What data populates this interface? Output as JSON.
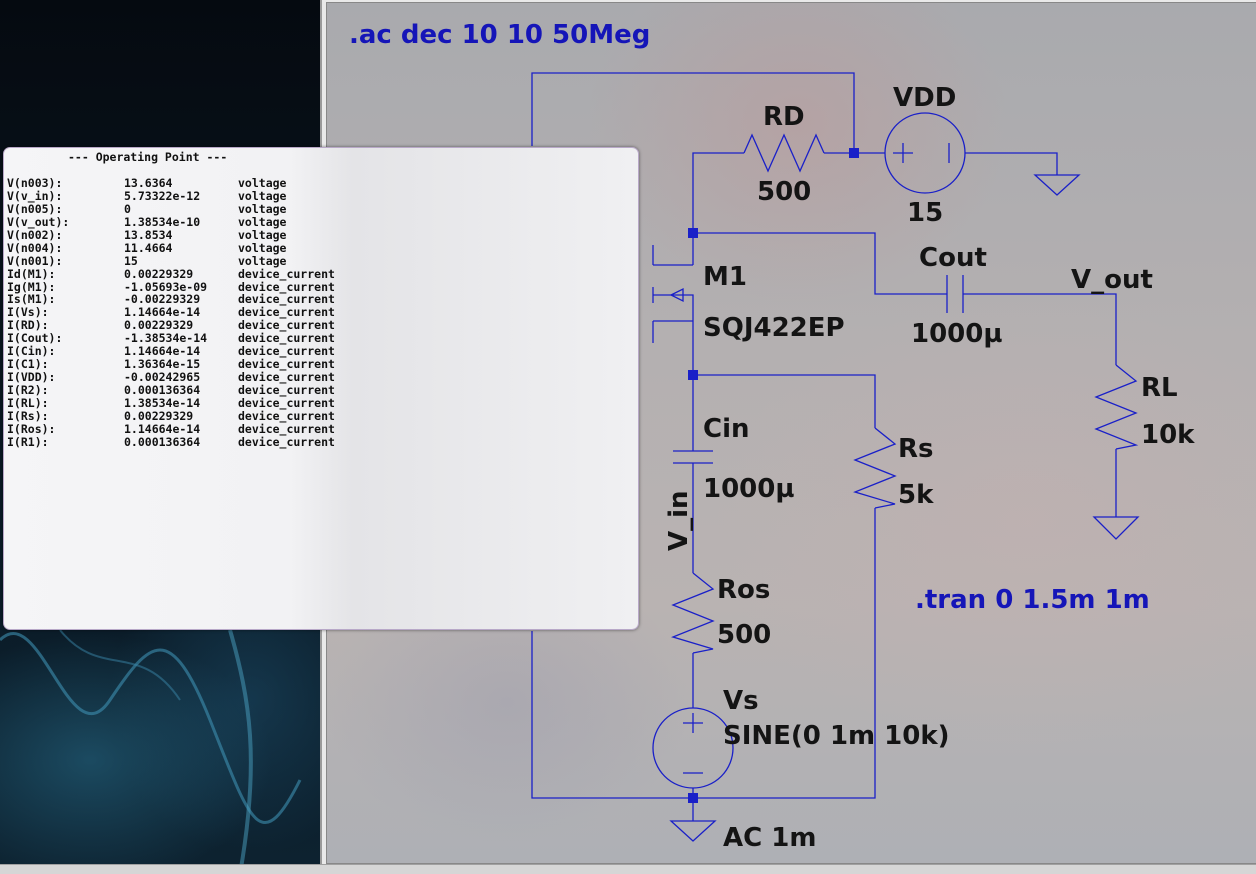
{
  "schematic": {
    "directives": {
      "ac": ".ac dec 10 10 50Meg",
      "tran": ".tran 0 1.5m 1m"
    },
    "components": {
      "rd": {
        "name": "RD",
        "value": "500"
      },
      "vdd": {
        "name": "VDD",
        "value": "15"
      },
      "m1": {
        "name": "M1",
        "model": "SQJ422EP"
      },
      "cout": {
        "name": "Cout",
        "value": "1000µ"
      },
      "rl": {
        "name": "RL",
        "value": "10k"
      },
      "cin": {
        "name": "Cin",
        "value": "1000µ"
      },
      "rs": {
        "name": "Rs",
        "value": "5k"
      },
      "ros": {
        "name": "Ros",
        "value": "500"
      },
      "vs": {
        "name": "Vs",
        "value": "SINE(0 1m 10k)",
        "ac": "AC 1m"
      }
    },
    "nets": {
      "v_out": "V_out",
      "v_in": "V_in"
    },
    "colors": {
      "wire": "#1a20c8",
      "directive": "#1515b8",
      "label": "#141414"
    }
  },
  "operating_point": {
    "title": "--- Operating Point ---",
    "rows": [
      {
        "name": "V(n003):",
        "value": "13.6364",
        "unit": "voltage"
      },
      {
        "name": "V(v_in):",
        "value": "5.73322e-12",
        "unit": "voltage"
      },
      {
        "name": "V(n005):",
        "value": "0",
        "unit": "voltage"
      },
      {
        "name": "V(v_out):",
        "value": "1.38534e-10",
        "unit": "voltage"
      },
      {
        "name": "V(n002):",
        "value": "13.8534",
        "unit": "voltage"
      },
      {
        "name": "V(n004):",
        "value": "11.4664",
        "unit": "voltage"
      },
      {
        "name": "V(n001):",
        "value": "15",
        "unit": "voltage"
      },
      {
        "name": "Id(M1):",
        "value": "0.00229329",
        "unit": "device_current"
      },
      {
        "name": "Ig(M1):",
        "value": "-1.05693e-09",
        "unit": "device_current"
      },
      {
        "name": "Is(M1):",
        "value": "-0.00229329",
        "unit": "device_current"
      },
      {
        "name": "I(Vs):",
        "value": "1.14664e-14",
        "unit": "device_current"
      },
      {
        "name": "I(RD):",
        "value": "0.00229329",
        "unit": "device_current"
      },
      {
        "name": "I(Cout):",
        "value": "-1.38534e-14",
        "unit": "device_current"
      },
      {
        "name": "I(Cin):",
        "value": "1.14664e-14",
        "unit": "device_current"
      },
      {
        "name": "I(C1):",
        "value": "1.36364e-15",
        "unit": "device_current"
      },
      {
        "name": "I(VDD):",
        "value": "-0.00242965",
        "unit": "device_current"
      },
      {
        "name": "I(R2):",
        "value": "0.000136364",
        "unit": "device_current"
      },
      {
        "name": "I(RL):",
        "value": "1.38534e-14",
        "unit": "device_current"
      },
      {
        "name": "I(Rs):",
        "value": "0.00229329",
        "unit": "device_current"
      },
      {
        "name": "I(Ros):",
        "value": "1.14664e-14",
        "unit": "device_current"
      },
      {
        "name": "I(R1):",
        "value": "0.000136364",
        "unit": "device_current"
      }
    ]
  }
}
